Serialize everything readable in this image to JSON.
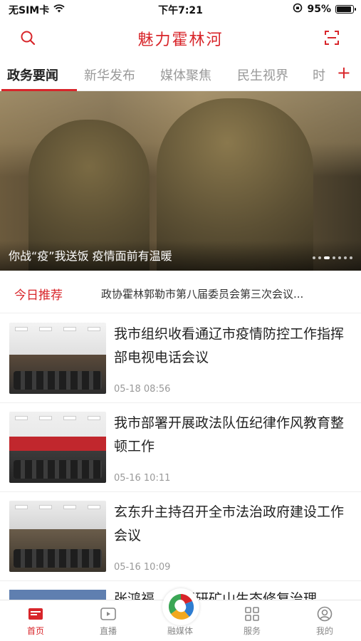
{
  "status_bar": {
    "carrier": "无SIM卡",
    "time": "下午7:21",
    "battery": "95%",
    "icons": [
      "wifi-icon",
      "orientation-lock-icon",
      "battery-icon"
    ]
  },
  "header": {
    "title": "魅力霍林河",
    "left_icon": "search-icon",
    "right_icon": "scan-icon"
  },
  "tabs": {
    "items": [
      {
        "label": "政务要闻"
      },
      {
        "label": "新华发布"
      },
      {
        "label": "媒体聚焦"
      },
      {
        "label": "民生视界"
      },
      {
        "label": "时"
      }
    ],
    "add_label": "+",
    "active_index": 0
  },
  "banner": {
    "caption": "你战“疫”我送饭 疫情面前有温暖",
    "slide_count": 7,
    "active_slide": 2
  },
  "today": {
    "label": "今日推荐",
    "headline": "政协霍林郭勒市第八届委员会第三次会议..."
  },
  "news": [
    {
      "title": "我市组织收看通辽市疫情防控工作指挥部电视电话会议",
      "time": "05-18 08:56"
    },
    {
      "title": "我市部署开展政法队伍纪律作风教育整顿工作",
      "time": "05-16 10:11"
    },
    {
      "title": "玄东升主持召开全市法治政府建设工作会议",
      "time": "05-16 10:09"
    },
    {
      "title": "张鸿福……调研矿山生态修复治理"
    }
  ],
  "bottom_nav": {
    "items": [
      {
        "label": "首页",
        "icon": "home-icon"
      },
      {
        "label": "直播",
        "icon": "live-icon"
      },
      {
        "label": "融媒体",
        "icon": "media-logo-icon"
      },
      {
        "label": "服务",
        "icon": "grid-icon"
      },
      {
        "label": "我的",
        "icon": "profile-icon"
      }
    ],
    "active_index": 0
  },
  "colors": {
    "accent": "#d8252a",
    "muted": "#999999"
  }
}
